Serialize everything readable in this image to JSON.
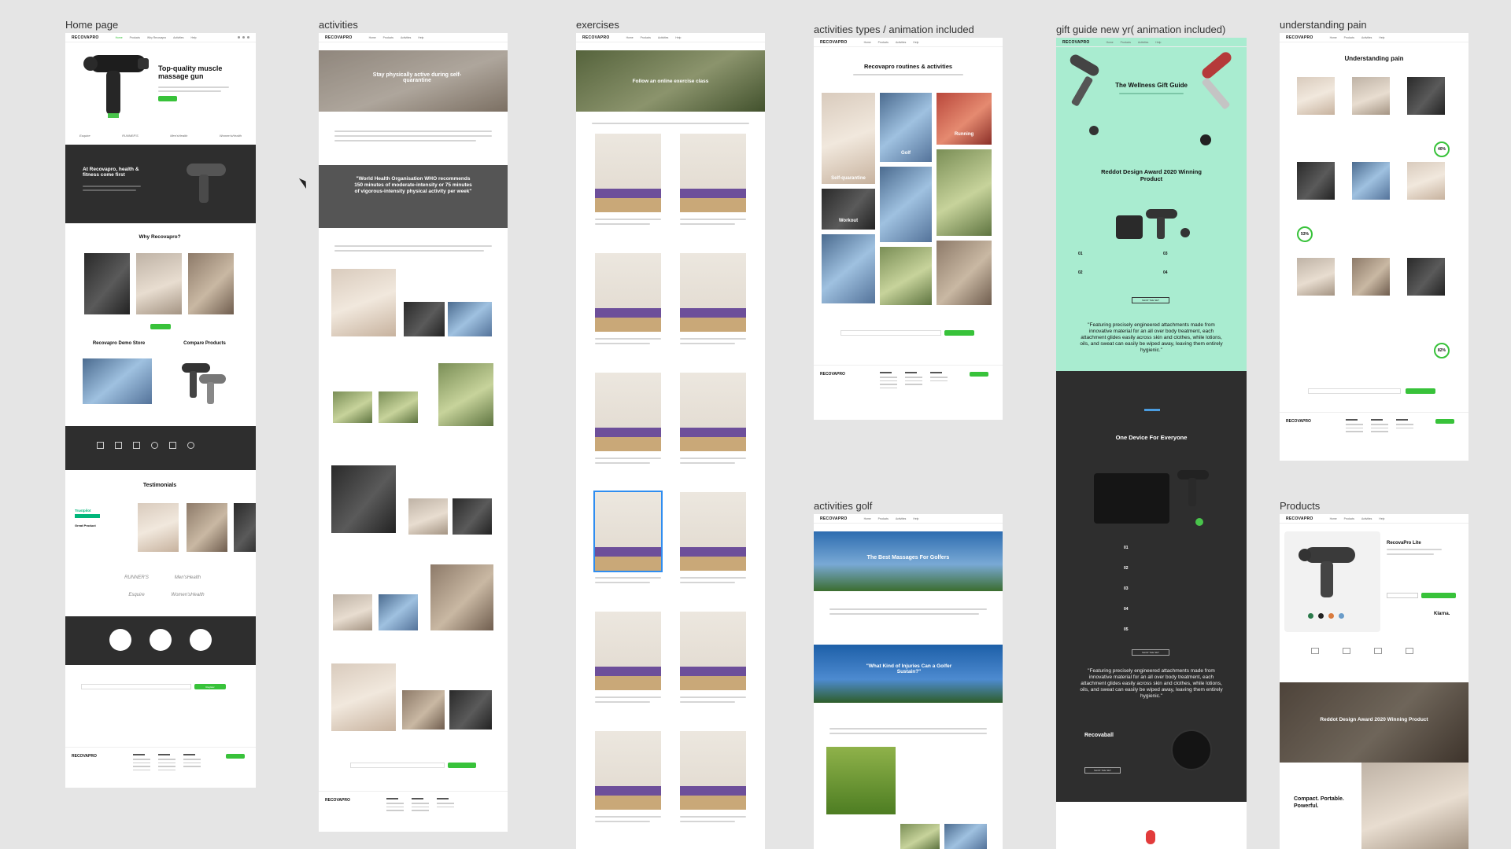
{
  "frames": {
    "home": {
      "label": "Home page",
      "hero_title": "Top-quality muscle massage gun",
      "band_title": "At Recovapro, health & fitness come first",
      "why_title": "Why Recovapro?",
      "demo_title": "Recovapro Demo Store",
      "compare_title": "Compare Products",
      "testimonials_title": "Testimonials",
      "trustpilot": "Trustpilot",
      "great_product": "Great Product",
      "press": [
        "RUNNER'S",
        "Men'sHealth",
        "Esquire",
        "Women'sHealth"
      ],
      "press_top": [
        "Esquire",
        "RUNNER'S",
        "Men'sHealth",
        "Women'sHealth"
      ],
      "register": "Register"
    },
    "activities": {
      "label": "activities",
      "hero_title": "Stay physically active during self-quarantine",
      "quote": "\"World Health Organisation WHO recommends 150 minutes of moderate-intensity or 75 minutes of vigorous-intensity physical activity per week\""
    },
    "exercises": {
      "label": "exercises",
      "hero_title": "Follow an online exercise class"
    },
    "activities_types": {
      "label": "activities types / animation included",
      "title": "Recovapro routines & activities",
      "tiles": [
        "Golf",
        "Running",
        "Self-quarantine",
        "Workout"
      ]
    },
    "activities_golf": {
      "label": "activities golf",
      "hero_title": "The Best Massages For Golfers",
      "quote": "\"What Kind of Injuries Can a Golfer Sustain?\""
    },
    "gift_guide": {
      "label": "gift guide new yr( animation included)",
      "title": "The Wellness Gift Guide",
      "award": "Reddot Design Award 2020 Winning Product",
      "list": [
        "01",
        "02",
        "03",
        "04"
      ],
      "quote": "\"Featuring precisely engineered attachments made from innovative material for an all over body treatment, each attachment glides easily across skin and clothes, while lotions, oils, and sweat can easily be wiped away, leaving them entirely hygienic.\"",
      "dark_title": "One Device For Everyone",
      "dark_list": [
        "01",
        "02",
        "03",
        "04",
        "05"
      ],
      "ball_title": "Recovaball",
      "shop": "SHOP THE SET"
    },
    "understanding": {
      "label": "understanding pain",
      "title": "Understanding pain",
      "stats": [
        "40%",
        "53%",
        "82%"
      ]
    },
    "products": {
      "label": "Products",
      "product_name": "RecovaPro Lite",
      "award": "Reddot Design Award 2020 Winning Product",
      "tagline": "Compact. Portable. Powerful.",
      "klarna": "Klarna."
    }
  },
  "brand": "RECOVAPRO",
  "colors": {
    "green": "#38c23a",
    "mint": "#a9ecd0",
    "dark": "#2e2e2e"
  }
}
